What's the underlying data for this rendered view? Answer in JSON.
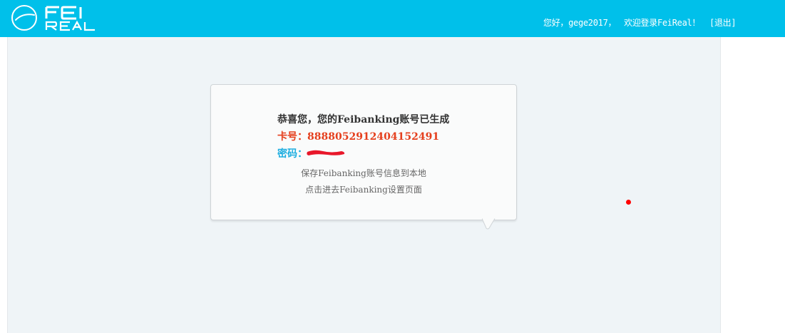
{
  "header": {
    "logo_alt": "FEI REAL",
    "greeting": "您好，gege2017，",
    "welcome": "欢迎登录FeiReal！",
    "logout_label": "[退出]",
    "bg_color": "#00c0ea"
  },
  "card": {
    "title": "恭喜您，您的Feibanking账号已生成",
    "card_number_label": "卡号：",
    "card_number": "8888052912404152491",
    "password_label": "密码：",
    "save_link": "保存Feibanking账号信息到本地",
    "settings_link": "点击进去Feibanking设置页面"
  },
  "colors": {
    "card_number": "#e53f1d",
    "password_label": "#1eaee0",
    "redaction": "#e8172a",
    "content_bg": "#eff4f7"
  }
}
